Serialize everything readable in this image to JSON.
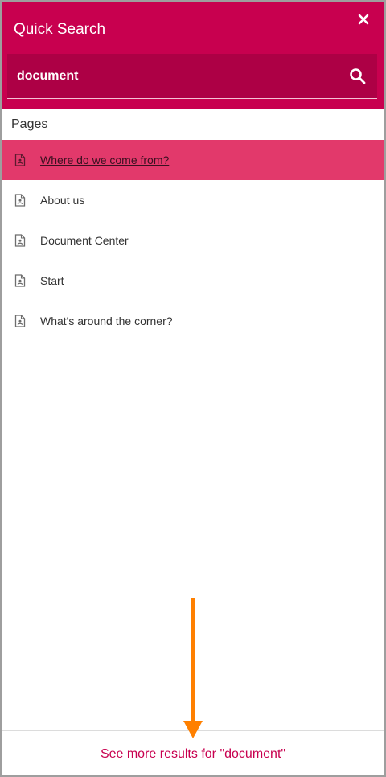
{
  "header": {
    "title": "Quick Search",
    "close_icon": "close-icon",
    "accent_color": "#c8004f"
  },
  "search": {
    "value": "document",
    "icon": "search-icon"
  },
  "results": {
    "section_title": "Pages",
    "items": [
      {
        "label": "Where do we come from?",
        "icon": "document-icon",
        "highlighted": true
      },
      {
        "label": "About us",
        "icon": "document-icon",
        "highlighted": false
      },
      {
        "label": "Document Center",
        "icon": "document-icon",
        "highlighted": false
      },
      {
        "label": "Start",
        "icon": "document-icon",
        "highlighted": false
      },
      {
        "label": "What's around the corner?",
        "icon": "document-icon",
        "highlighted": false
      }
    ]
  },
  "footer": {
    "more_results": "See more results for \"document\""
  },
  "annotation": {
    "icon": "arrow-down-icon",
    "color": "#ff8000"
  }
}
